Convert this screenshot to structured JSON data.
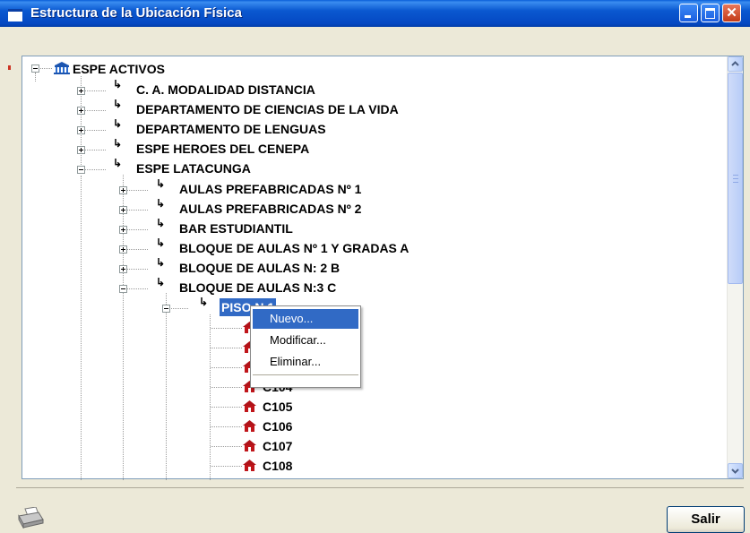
{
  "window": {
    "title": "Estructura de la Ubicación Física"
  },
  "tree": {
    "root": "ESPE ACTIVOS",
    "level1": [
      "C. A. MODALIDAD DISTANCIA",
      "DEPARTAMENTO DE CIENCIAS DE LA VIDA",
      "DEPARTAMENTO DE LENGUAS",
      "ESPE HEROES DEL CENEPA",
      "ESPE LATACUNGA"
    ],
    "level2": [
      "AULAS PREFABRICADAS Nº 1",
      "AULAS PREFABRICADAS Nº 2",
      "BAR ESTUDIANTIL",
      "BLOQUE DE AULAS Nº 1 Y GRADAS  A",
      "BLOQUE DE AULAS N: 2 B",
      "BLOQUE DE AULAS N:3 C"
    ],
    "selected": "PISO N 1",
    "rooms": [
      "C104",
      "C105",
      "C106",
      "C107",
      "C108"
    ]
  },
  "context_menu": {
    "items": [
      "Nuevo...",
      "Modificar...",
      "Eliminar..."
    ],
    "highlighted": "Nuevo..."
  },
  "footer": {
    "exit_label": "Salir"
  },
  "icons": {
    "building": "building-icon",
    "branch": "branch-icon",
    "room": "house-icon",
    "print": "printer-icon"
  },
  "colors": {
    "title_bar": "#0a58d0",
    "selection": "#316ac5",
    "room_icon": "#c0151a"
  }
}
